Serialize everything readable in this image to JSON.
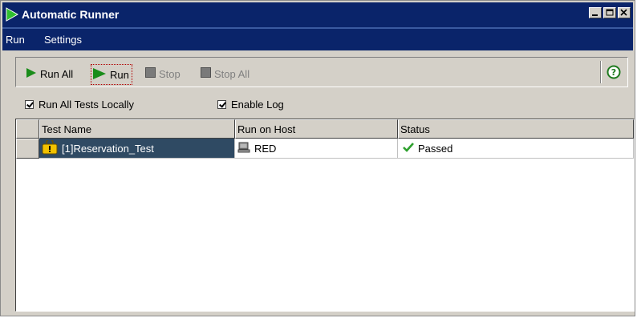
{
  "window": {
    "title": "Automatic Runner"
  },
  "menu": [
    "Run",
    "Settings"
  ],
  "toolbar": {
    "run_all": "Run All",
    "run": "Run",
    "stop": "Stop",
    "stop_all": "Stop All",
    "help_icon": "help-icon"
  },
  "options": {
    "run_locally": "Run All Tests Locally",
    "enable_log": "Enable Log"
  },
  "table": {
    "headers": [
      "Test Name",
      "Run on Host",
      "Status"
    ],
    "rows": [
      {
        "test_name": "[1]Reservation_Test",
        "host": "RED",
        "status": "Passed"
      }
    ]
  },
  "colors": {
    "titlebar": "#0a246a",
    "run_green": "#1a8c1a",
    "selected_row": "#2f4a63"
  }
}
